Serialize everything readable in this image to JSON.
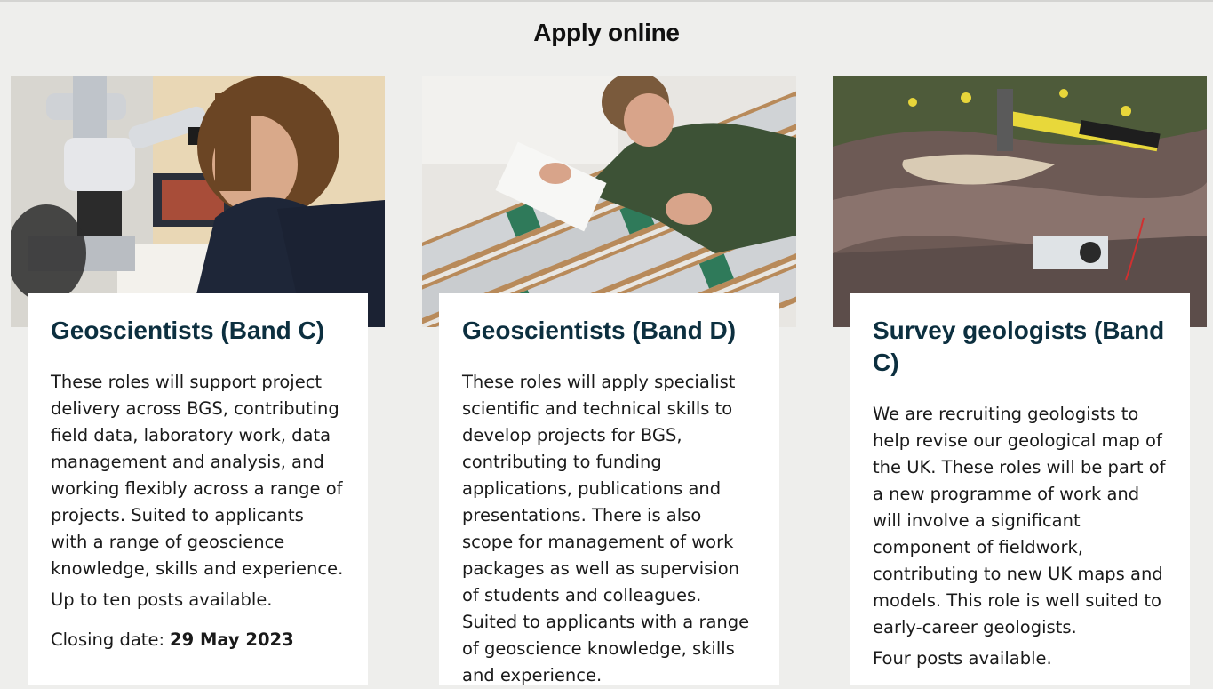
{
  "page": {
    "title": "Apply online"
  },
  "cards": [
    {
      "title": "Geoscientists (Band C)",
      "description": "These roles will support project delivery across BGS, contributing field data, laboratory work, data management and analysis, and working flexibly across a range of projects. Suited to applicants with a range of geoscience knowledge, skills and experience.",
      "posts": "Up to ten posts available.",
      "closing_label": "Closing date:",
      "closing_date": "29 May 2023",
      "image_alt": "Researcher looking into a microscope"
    },
    {
      "title": "Geoscientists (Band D)",
      "description": "These roles will apply specialist scientific and technical skills to develop projects for BGS, contributing to funding applications, publications and presentations. There is also scope for management of work packages as well as supervision of students and colleagues. Suited to applicants with a range of geoscience knowledge, skills and experience.",
      "image_alt": "Scientist examining core samples in boxes"
    },
    {
      "title": "Survey geologists (Band C)",
      "description": "We are recruiting geologists to help revise our geological map of the UK. These roles will be part of a new programme of work and will involve a significant component of fieldwork, contributing to new UK maps and models. This role is well suited to early-career geologists.",
      "posts": "Four posts available.",
      "image_alt": "Geological hammer and compass on rock outcrop"
    }
  ],
  "colors": {
    "background": "#eeeeec",
    "card": "#ffffff",
    "title": "#0c2f3f",
    "text": "#1a1a1a"
  },
  "icons": [
    "microscope-photo",
    "core-samples-photo",
    "rock-outcrop-photo"
  ]
}
